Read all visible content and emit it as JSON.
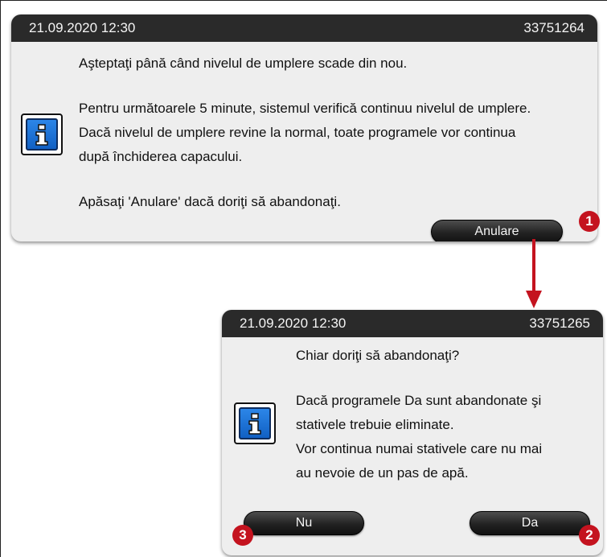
{
  "dialog1": {
    "datetime": "21.09.2020 12:30",
    "message_id": "33751264",
    "lines": [
      "Aşteptaţi până când nivelul de umplere scade din nou.",
      "Pentru următoarele 5 minute, sistemul verifică continuu nivelul de umplere.",
      "Dacă nivelul de umplere revine la normal, toate programele vor continua",
      "după închiderea capacului.",
      "Apăsaţi 'Anulare' dacă doriţi să abandonaţi."
    ],
    "cancel_label": "Anulare",
    "cancel_badge": "1"
  },
  "dialog2": {
    "datetime": "21.09.2020 12:30",
    "message_id": "33751265",
    "lines": [
      "Chiar doriţi să abandonaţi?",
      "Dacă programele Da sunt abandonate şi",
      "stativele trebuie eliminate.",
      "Vor continua numai stativele care nu mai",
      "au nevoie de un pas de apă."
    ],
    "no_label": "Nu",
    "no_badge": "3",
    "yes_label": "Da",
    "yes_badge": "2"
  },
  "icons": {
    "info": "info-icon",
    "arrow": "arrow-down-icon"
  },
  "colors": {
    "badge": "#c4131f",
    "titlebar": "#2a2a2a",
    "info_blue": "#1e6fd9",
    "arrow": "#c4131f"
  }
}
